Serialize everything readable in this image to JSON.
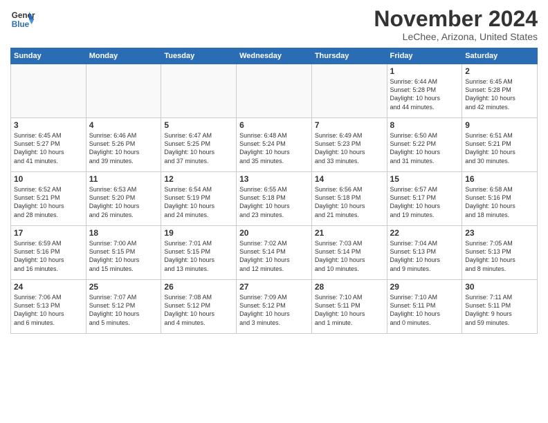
{
  "header": {
    "logo_line1": "General",
    "logo_line2": "Blue",
    "month_title": "November 2024",
    "location": "LeChee, Arizona, United States"
  },
  "weekdays": [
    "Sunday",
    "Monday",
    "Tuesday",
    "Wednesday",
    "Thursday",
    "Friday",
    "Saturday"
  ],
  "weeks": [
    [
      {
        "day": "",
        "info": ""
      },
      {
        "day": "",
        "info": ""
      },
      {
        "day": "",
        "info": ""
      },
      {
        "day": "",
        "info": ""
      },
      {
        "day": "",
        "info": ""
      },
      {
        "day": "1",
        "info": "Sunrise: 6:44 AM\nSunset: 5:28 PM\nDaylight: 10 hours\nand 44 minutes."
      },
      {
        "day": "2",
        "info": "Sunrise: 6:45 AM\nSunset: 5:28 PM\nDaylight: 10 hours\nand 42 minutes."
      }
    ],
    [
      {
        "day": "3",
        "info": "Sunrise: 6:45 AM\nSunset: 5:27 PM\nDaylight: 10 hours\nand 41 minutes."
      },
      {
        "day": "4",
        "info": "Sunrise: 6:46 AM\nSunset: 5:26 PM\nDaylight: 10 hours\nand 39 minutes."
      },
      {
        "day": "5",
        "info": "Sunrise: 6:47 AM\nSunset: 5:25 PM\nDaylight: 10 hours\nand 37 minutes."
      },
      {
        "day": "6",
        "info": "Sunrise: 6:48 AM\nSunset: 5:24 PM\nDaylight: 10 hours\nand 35 minutes."
      },
      {
        "day": "7",
        "info": "Sunrise: 6:49 AM\nSunset: 5:23 PM\nDaylight: 10 hours\nand 33 minutes."
      },
      {
        "day": "8",
        "info": "Sunrise: 6:50 AM\nSunset: 5:22 PM\nDaylight: 10 hours\nand 31 minutes."
      },
      {
        "day": "9",
        "info": "Sunrise: 6:51 AM\nSunset: 5:21 PM\nDaylight: 10 hours\nand 30 minutes."
      }
    ],
    [
      {
        "day": "10",
        "info": "Sunrise: 6:52 AM\nSunset: 5:21 PM\nDaylight: 10 hours\nand 28 minutes."
      },
      {
        "day": "11",
        "info": "Sunrise: 6:53 AM\nSunset: 5:20 PM\nDaylight: 10 hours\nand 26 minutes."
      },
      {
        "day": "12",
        "info": "Sunrise: 6:54 AM\nSunset: 5:19 PM\nDaylight: 10 hours\nand 24 minutes."
      },
      {
        "day": "13",
        "info": "Sunrise: 6:55 AM\nSunset: 5:18 PM\nDaylight: 10 hours\nand 23 minutes."
      },
      {
        "day": "14",
        "info": "Sunrise: 6:56 AM\nSunset: 5:18 PM\nDaylight: 10 hours\nand 21 minutes."
      },
      {
        "day": "15",
        "info": "Sunrise: 6:57 AM\nSunset: 5:17 PM\nDaylight: 10 hours\nand 19 minutes."
      },
      {
        "day": "16",
        "info": "Sunrise: 6:58 AM\nSunset: 5:16 PM\nDaylight: 10 hours\nand 18 minutes."
      }
    ],
    [
      {
        "day": "17",
        "info": "Sunrise: 6:59 AM\nSunset: 5:16 PM\nDaylight: 10 hours\nand 16 minutes."
      },
      {
        "day": "18",
        "info": "Sunrise: 7:00 AM\nSunset: 5:15 PM\nDaylight: 10 hours\nand 15 minutes."
      },
      {
        "day": "19",
        "info": "Sunrise: 7:01 AM\nSunset: 5:15 PM\nDaylight: 10 hours\nand 13 minutes."
      },
      {
        "day": "20",
        "info": "Sunrise: 7:02 AM\nSunset: 5:14 PM\nDaylight: 10 hours\nand 12 minutes."
      },
      {
        "day": "21",
        "info": "Sunrise: 7:03 AM\nSunset: 5:14 PM\nDaylight: 10 hours\nand 10 minutes."
      },
      {
        "day": "22",
        "info": "Sunrise: 7:04 AM\nSunset: 5:13 PM\nDaylight: 10 hours\nand 9 minutes."
      },
      {
        "day": "23",
        "info": "Sunrise: 7:05 AM\nSunset: 5:13 PM\nDaylight: 10 hours\nand 8 minutes."
      }
    ],
    [
      {
        "day": "24",
        "info": "Sunrise: 7:06 AM\nSunset: 5:13 PM\nDaylight: 10 hours\nand 6 minutes."
      },
      {
        "day": "25",
        "info": "Sunrise: 7:07 AM\nSunset: 5:12 PM\nDaylight: 10 hours\nand 5 minutes."
      },
      {
        "day": "26",
        "info": "Sunrise: 7:08 AM\nSunset: 5:12 PM\nDaylight: 10 hours\nand 4 minutes."
      },
      {
        "day": "27",
        "info": "Sunrise: 7:09 AM\nSunset: 5:12 PM\nDaylight: 10 hours\nand 3 minutes."
      },
      {
        "day": "28",
        "info": "Sunrise: 7:10 AM\nSunset: 5:11 PM\nDaylight: 10 hours\nand 1 minute."
      },
      {
        "day": "29",
        "info": "Sunrise: 7:10 AM\nSunset: 5:11 PM\nDaylight: 10 hours\nand 0 minutes."
      },
      {
        "day": "30",
        "info": "Sunrise: 7:11 AM\nSunset: 5:11 PM\nDaylight: 9 hours\nand 59 minutes."
      }
    ]
  ]
}
